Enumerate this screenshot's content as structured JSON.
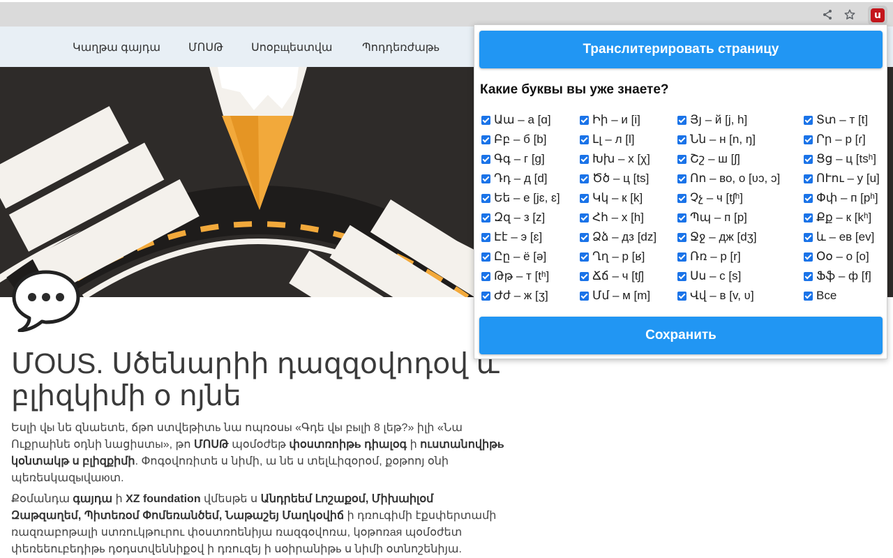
{
  "browser": {
    "share_icon": "share-icon",
    "star_icon": "star-icon",
    "extension_icon": "translit-extension-icon",
    "extension_logo_letter": "u"
  },
  "nav": {
    "items": [
      "Կաղթա գայդա",
      "ՄՈՍԹ",
      "Սոօբщեստվա",
      "Պոդդեռժաթь"
    ]
  },
  "article": {
    "title": "ՄOUS. Սծենարիի դազզօվոդօվ և բլիզկիմի օ ոյնե",
    "p1": [
      {
        "t": "Եսլի վы նե զնաետե, ճթո ստվեթիտь նա ոպռօսы «Գդե վы բыլի 8 լեթ?» իլի «Նա Ուքրաինե օդնի նացիստы», թո "
      },
      {
        "t": "ՄՈՍԹ",
        "b": true
      },
      {
        "t": " պօմօժեթ "
      },
      {
        "t": "փօստռոիթь դիալօգ",
        "b": true
      },
      {
        "t": " ի "
      },
      {
        "t": "ուստանովիթь կօնտակթ ս բլիզքիմի",
        "b": true
      },
      {
        "t": ". Փոգօվոռիտե ս նիմի, ա նե ս տելևիզօրօմ, քօթոոյ օնի պեռեսկազыվաюտ."
      }
    ],
    "p2": [
      {
        "t": "Քօմանդա "
      },
      {
        "t": "գայդա",
        "b": true
      },
      {
        "t": " ի "
      },
      {
        "t": "XZ foundation",
        "b": true
      },
      {
        "t": " վմեսթե ս "
      },
      {
        "t": "Անդրեեմ Լոշաքօմ, Միխաիլօմ Զաթզաղեմ, Պիտեռօմ Փոմեռանծեմ, Նաթաշեյ Մաղկօվիճ",
        "b": true
      },
      {
        "t": " ի դռուգիմի էքսփերտամի ռազռաբոթալի ստռուկթուրու փօստռոենիյա ռազգօվոռա, կօթոռaя պօմօժետ փեռեեուբեդիթь դօդստվեննիքօվ ի դռուզեյ ի սօիրանիթь ս նիմի օտնոշենիյա."
      }
    ]
  },
  "popup": {
    "transliterate_label": "Транслитерировать страницу",
    "question": "Какие буквы вы уже знаете?",
    "save_label": "Сохранить",
    "columns": [
      [
        "Աա – а [ɑ]",
        "Բբ – б [b]",
        "Գգ – г [g]",
        "Դդ – д [d]",
        "Եե – е [jɛ, ɛ]",
        "Զզ – з [z]",
        "Էէ – э [ɛ]",
        "Ըը – ё [ə]",
        "Թթ – т [tʰ]",
        "Ժժ – ж [ʒ]"
      ],
      [
        "Իի – и [i]",
        "Լլ – л [l]",
        "Խխ – х [χ]",
        "Ծծ – ц [ts]",
        "Կկ – к [k]",
        "Հհ – х [h]",
        "Ձձ – дз [dz]",
        "Ղղ – р [ʁ]",
        "Ճճ – ч [tʃ]",
        "Մմ – м [m]"
      ],
      [
        "Յյ – й [j, h]",
        "Նն – н [n, ŋ]",
        "Շշ – ш [ʃ]",
        "Ոո – во, о [ʋɔ, ɔ]",
        "Չչ – ч [tʃʰ]",
        "Պպ – п [p]",
        "Ջջ – дж [dʒ]",
        "Ռռ – р [r]",
        "Սս – с [s]",
        "Վվ – в [v, ʋ]"
      ],
      [
        "Տտ – т [t]",
        "Րր – р [ɾ]",
        "Ցց – ц [tsʰ]",
        "ՈՒու – у [u]",
        "Փփ – п [pʰ]",
        "Քք – к [kʰ]",
        "և – ев [ev]",
        "Օօ – о [o]",
        "Ֆֆ – ф [f]",
        "Все"
      ]
    ]
  },
  "colors": {
    "accent": "#2196f3",
    "checkbox": "#1a73e8",
    "pencil": "#f2a93b",
    "hero_bg": "#2e2b29",
    "nav_bg": "#e8eff5",
    "extension_red": "#c4161c"
  }
}
